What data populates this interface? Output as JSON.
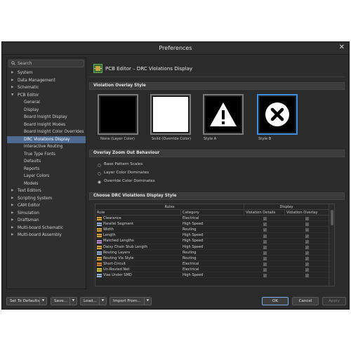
{
  "window": {
    "title": "Preferences",
    "close_glyph": "✕"
  },
  "search": {
    "label": "Search",
    "icon": "search-icon"
  },
  "tree": [
    {
      "label": "System",
      "level": 0,
      "arrow": "▶"
    },
    {
      "label": "Data Management",
      "level": 0,
      "arrow": "▶"
    },
    {
      "label": "Schematic",
      "level": 0,
      "arrow": "▶"
    },
    {
      "label": "PCB Editor",
      "level": 0,
      "arrow": "▼"
    },
    {
      "label": "General",
      "level": 1
    },
    {
      "label": "Display",
      "level": 1
    },
    {
      "label": "Board Insight Display",
      "level": 1
    },
    {
      "label": "Board Insight Modes",
      "level": 1
    },
    {
      "label": "Board Insight Color Overrides",
      "level": 1
    },
    {
      "label": "DRC Violations Display",
      "level": 1,
      "selected": true
    },
    {
      "label": "Interactive Routing",
      "level": 1
    },
    {
      "label": "True Type Fonts",
      "level": 1
    },
    {
      "label": "Defaults",
      "level": 1
    },
    {
      "label": "Reports",
      "level": 1
    },
    {
      "label": "Layer Colors",
      "level": 1
    },
    {
      "label": "Models",
      "level": 1
    },
    {
      "label": "Text Editors",
      "level": 0,
      "arrow": "▶"
    },
    {
      "label": "Scripting System",
      "level": 0,
      "arrow": "▶"
    },
    {
      "label": "CAM Editor",
      "level": 0,
      "arrow": "▶"
    },
    {
      "label": "Simulation",
      "level": 0,
      "arrow": "▶"
    },
    {
      "label": "Draftsman",
      "level": 0,
      "arrow": "▶"
    },
    {
      "label": "Multi-board Schematic",
      "level": 0,
      "arrow": "▶"
    },
    {
      "label": "Multi-board Assembly",
      "level": 0,
      "arrow": "▶"
    }
  ],
  "page": {
    "title": "PCB Editor – DRC Violations Display"
  },
  "overlay_style": {
    "section": "Violation Overlay Style",
    "tiles": [
      {
        "label": "None (Layer Color)",
        "kind": "black"
      },
      {
        "label": "Solid (Override Color)",
        "kind": "white"
      },
      {
        "label": "Style A",
        "kind": "warning"
      },
      {
        "label": "Style B",
        "kind": "xcircle",
        "selected": true
      }
    ]
  },
  "zoom": {
    "section": "Overlay Zoom Out Behaviour",
    "options": [
      {
        "label": "Base Pattern Scales",
        "selected": false
      },
      {
        "label": "Layer Color Dominates",
        "selected": false
      },
      {
        "label": "Override Color Dominates",
        "selected": true
      }
    ]
  },
  "display_style": {
    "section": "Choose DRC Violations Display Style",
    "groups": {
      "rules": "Rules",
      "display": "Display"
    },
    "columns": {
      "rule": "Rule",
      "category": "Category",
      "details": "Violation Details",
      "overlay": "Violation Overlay"
    },
    "rows": [
      {
        "rule": "Clearance",
        "category": "Electrical",
        "details": true,
        "overlay": true
      },
      {
        "rule": "Parallel Segment",
        "category": "High Speed",
        "details": true,
        "overlay": true
      },
      {
        "rule": "Width",
        "category": "Routing",
        "details": true,
        "overlay": true
      },
      {
        "rule": "Length",
        "category": "High Speed",
        "details": true,
        "overlay": true
      },
      {
        "rule": "Matched Lengths",
        "category": "High Speed",
        "details": true,
        "overlay": true
      },
      {
        "rule": "Daisy Chain Stub Length",
        "category": "High Speed",
        "details": true,
        "overlay": true
      },
      {
        "rule": "Routing Layers",
        "category": "Routing",
        "details": true,
        "overlay": true
      },
      {
        "rule": "Routing Via Style",
        "category": "Routing",
        "details": true,
        "overlay": true
      },
      {
        "rule": "Short-Circuit",
        "category": "Electrical",
        "details": true,
        "overlay": true
      },
      {
        "rule": "Un-Routed Net",
        "category": "Electrical",
        "details": true,
        "overlay": true
      },
      {
        "rule": "Vias Under SMD",
        "category": "High Speed",
        "details": true,
        "overlay": true
      }
    ]
  },
  "footer": {
    "set_defaults": "Set To Defaults",
    "save": "Save...",
    "load": "Load...",
    "import": "Import From...",
    "ok": "OK",
    "cancel": "Cancel",
    "apply": "Apply",
    "dropdown_glyph": "▼"
  },
  "checkmark": "✓",
  "colors": {
    "selection": "#4f6a91",
    "accent": "#3b8ee0",
    "window_bg": "#2b2b2b"
  }
}
